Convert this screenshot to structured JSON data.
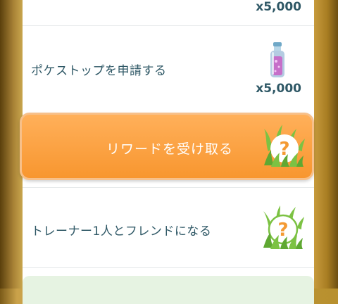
{
  "tasks": [
    {
      "reward_count": "x5,000"
    },
    {
      "label": "ポケストップを申請する",
      "reward_count": "x5,000",
      "reward_icon": "stardust-potion-icon"
    },
    {
      "label": "トレーナー1人とフレンドになる",
      "reward_icon": "mystery-reward-icon"
    }
  ],
  "claim_button": {
    "label": "リワードを受け取る",
    "icon": "mystery-reward-icon"
  },
  "colors": {
    "claim_button": "#f8962f",
    "text": "#2f5866",
    "grass": "#7cc243",
    "question_mark": "#f49a33",
    "gold_background": "#b8902e"
  }
}
